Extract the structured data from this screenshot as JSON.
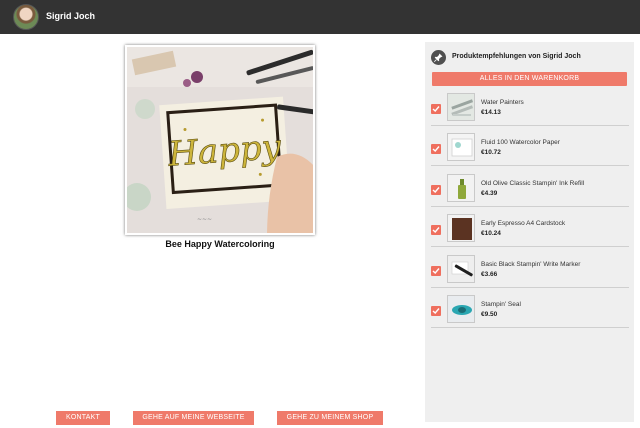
{
  "header": {
    "author_name": "Sigrid Joch"
  },
  "photo": {
    "caption": "Bee Happy Watercoloring",
    "card_text": "Happy"
  },
  "recommendations": {
    "title": "Produktempfehlungen von Sigrid Joch",
    "add_all_label": "ALLES IN DEN WARENKORB",
    "items": [
      {
        "name": "Water Painters",
        "price": "€14.13",
        "checked": true,
        "thumb_icon": "water-painters-icon"
      },
      {
        "name": "Fluid 100 Watercolor Paper",
        "price": "€10.72",
        "checked": true,
        "thumb_icon": "paper-icon"
      },
      {
        "name": "Old Olive Classic Stampin' Ink Refill",
        "price": "€4.39",
        "checked": true,
        "thumb_icon": "ink-bottle-icon"
      },
      {
        "name": "Early Espresso A4 Cardstock",
        "price": "€10.24",
        "checked": true,
        "thumb_icon": "cardstock-icon"
      },
      {
        "name": "Basic Black Stampin' Write Marker",
        "price": "€3.66",
        "checked": true,
        "thumb_icon": "marker-icon"
      },
      {
        "name": "Stampin' Seal",
        "price": "€9.50",
        "checked": true,
        "thumb_icon": "seal-icon"
      }
    ]
  },
  "footer": {
    "contact_label": "KONTAKT",
    "website_label": "GEHE AUF MEINE WEBSEITE",
    "shop_label": "GEHE ZU MEINEM SHOP"
  },
  "colors": {
    "accent": "#ef7a6a",
    "topbar": "#333333",
    "sidebar": "#efefef"
  }
}
